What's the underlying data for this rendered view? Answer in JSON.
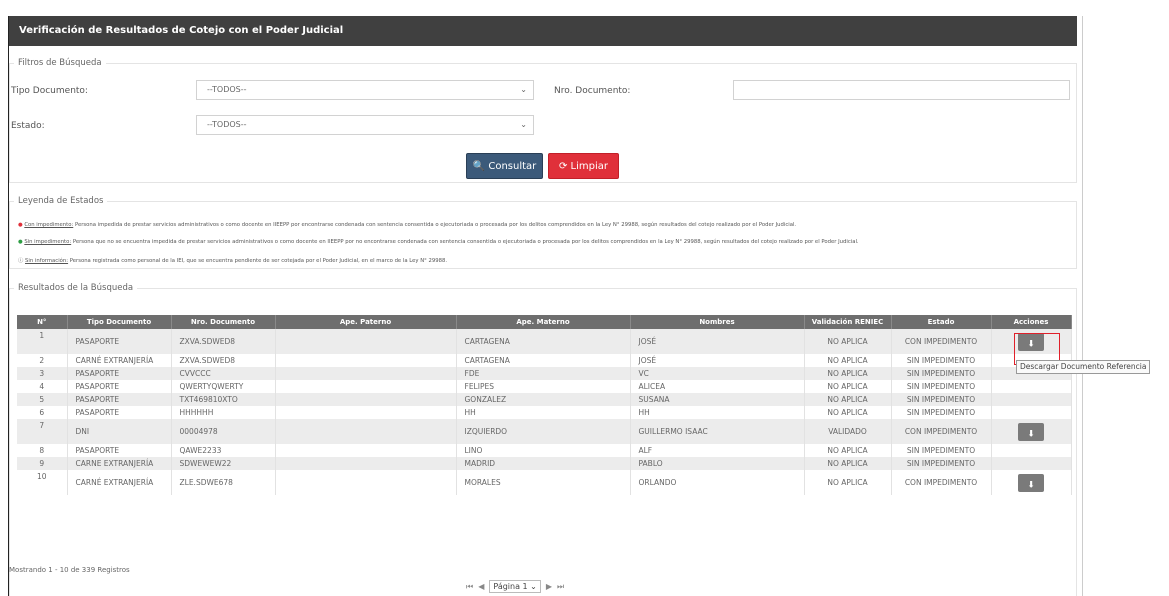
{
  "title": "Verificación de Resultados de Cotejo con el Poder Judicial",
  "filters": {
    "legend": "Filtros de Búsqueda",
    "tipo_documento_label": "Tipo Documento:",
    "tipo_documento_value": "--TODOS--",
    "estado_label": "Estado:",
    "estado_value": "--TODOS--",
    "nro_documento_label": "Nro. Documento:",
    "nro_documento_value": "",
    "consultar_label": "Consultar",
    "limpiar_label": "Limpiar"
  },
  "legend_states": {
    "legend": "Leyenda de Estados",
    "items": [
      {
        "term": "Con impedimento:",
        "text": " Persona impedida de prestar servicios administrativos o como docente en IIEEPP por encontrarse condenada con sentencia consentida o ejecutoriada o procesada por los delitos comprendidos en la Ley N° 29988, según resultados del cotejo realizado por el Poder Judicial.",
        "color": "#e0303a"
      },
      {
        "term": "Sin impedimento:",
        "text": " Persona que no se encuentra impedida de prestar servicios administrativos o como docente en IIEEPP por no encontrarse condenada con sentencia consentida o ejecutoriada o procesada por los delitos comprendidos en la Ley N° 29988, según resultados del cotejo realizado por el Poder Judicial.",
        "color": "#2e9e44"
      },
      {
        "term": "Sin información:",
        "text": " Persona registrada como personal de la IEI, que se encuentra pendiente de ser cotejada por el Poder Judicial, en el marco de la Ley N° 29988.",
        "color": "#555555"
      }
    ]
  },
  "results": {
    "legend": "Resultados de la Búsqueda",
    "columns": [
      "N°",
      "Tipo Documento",
      "Nro. Documento",
      "Ape. Paterno",
      "Ape. Materno",
      "Nombres",
      "Validación RENIEC",
      "Estado",
      "Acciones"
    ],
    "rows": [
      {
        "n": "1",
        "tipo": "PASAPORTE",
        "nro": "ZXVA.SDWED8",
        "paterno": "",
        "materno": "CARTAGENA",
        "nombres": "JOSÉ",
        "reniec": "NO APLICA",
        "estado": "CON IMPEDIMENTO",
        "action": true
      },
      {
        "n": "2",
        "tipo": "CARNÉ EXTRANJERÍA",
        "nro": "ZXVA.SDWED8",
        "paterno": "",
        "materno": "CARTAGENA",
        "nombres": "JOSÉ",
        "reniec": "NO APLICA",
        "estado": "SIN IMPEDIMENTO",
        "action": false
      },
      {
        "n": "3",
        "tipo": "PASAPORTE",
        "nro": "CVVCCC",
        "paterno": "",
        "materno": "FDE",
        "nombres": "VC",
        "reniec": "NO APLICA",
        "estado": "SIN IMPEDIMENTO",
        "action": false
      },
      {
        "n": "4",
        "tipo": "PASAPORTE",
        "nro": "QWERTYQWERTY",
        "paterno": "",
        "materno": "FELIPES",
        "nombres": "ALICEA",
        "reniec": "NO APLICA",
        "estado": "SIN IMPEDIMENTO",
        "action": false
      },
      {
        "n": "5",
        "tipo": "PASAPORTE",
        "nro": "TXT469810XTO",
        "paterno": "",
        "materno": "GONZALEZ",
        "nombres": "SUSANA",
        "reniec": "NO APLICA",
        "estado": "SIN IMPEDIMENTO",
        "action": false
      },
      {
        "n": "6",
        "tipo": "PASAPORTE",
        "nro": "HHHHHH",
        "paterno": "",
        "materno": "HH",
        "nombres": "HH",
        "reniec": "NO APLICA",
        "estado": "SIN IMPEDIMENTO",
        "action": false
      },
      {
        "n": "7",
        "tipo": "DNI",
        "nro": "00004978",
        "paterno": "",
        "materno": "IZQUIERDO",
        "nombres": "GUILLERMO ISAAC",
        "reniec": "VALIDADO",
        "estado": "CON IMPEDIMENTO",
        "action": true
      },
      {
        "n": "8",
        "tipo": "PASAPORTE",
        "nro": "QAWE2233",
        "paterno": "",
        "materno": "LINO",
        "nombres": "ALF",
        "reniec": "NO APLICA",
        "estado": "SIN IMPEDIMENTO",
        "action": false
      },
      {
        "n": "9",
        "tipo": "CARNE EXTRANJERÍA",
        "nro": "SDWEWEW22",
        "paterno": "",
        "materno": "MADRID",
        "nombres": "PABLO",
        "reniec": "NO APLICA",
        "estado": "SIN IMPEDIMENTO",
        "action": false
      },
      {
        "n": "10",
        "tipo": "CARNÉ EXTRANJERÍA",
        "nro": "ZLE.SDWE678",
        "paterno": "",
        "materno": "MORALES",
        "nombres": "ORLANDO",
        "reniec": "NO APLICA",
        "estado": "CON IMPEDIMENTO",
        "action": true
      }
    ],
    "tooltip": "Descargar Documento Referencia",
    "footer": "Mostrando  1 - 10 de 339 Registros"
  },
  "pager": {
    "first": "⏮",
    "prev": "◀",
    "page_label": "Página 1",
    "next": "▶",
    "last": "⏭"
  }
}
